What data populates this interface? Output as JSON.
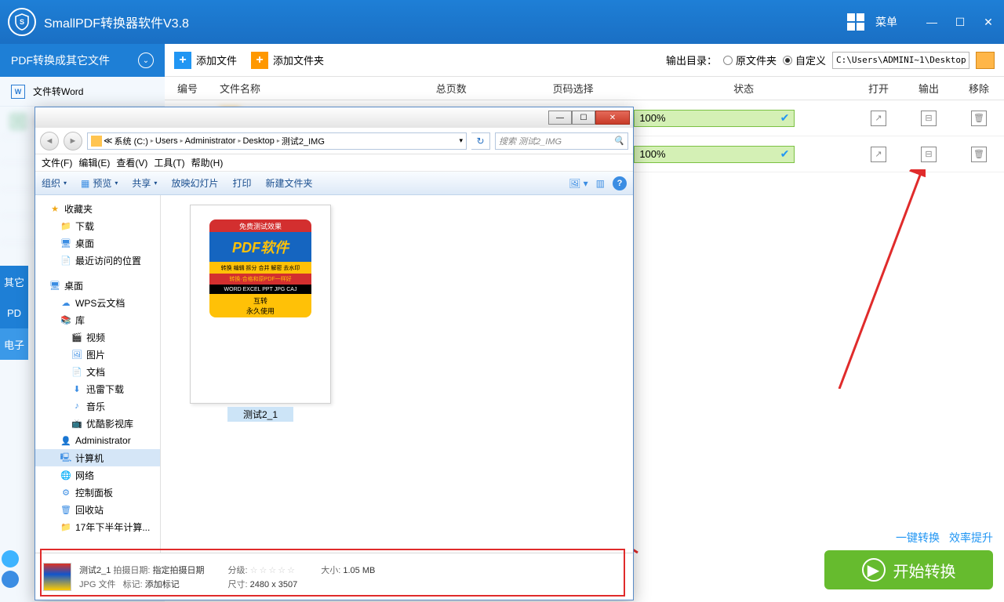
{
  "title_bar": {
    "app_title": "SmallPDF转换器软件V3.8",
    "menu_label": "菜单"
  },
  "sidebar": {
    "header": "PDF转换成其它文件",
    "items": [
      {
        "icon": "W",
        "color": "#2b7cd3",
        "label": "文件转Word"
      }
    ],
    "strip": [
      "其它",
      "PD",
      "电子"
    ]
  },
  "toolbar": {
    "add_file": "添加文件",
    "add_folder": "添加文件夹",
    "out_dir_label": "输出目录：",
    "radio_original": "原文件夹",
    "radio_custom": "自定义",
    "path": "C:\\Users\\ADMINI~1\\Desktop"
  },
  "grid": {
    "cols": {
      "num": "编号",
      "name": "文件名称",
      "pages": "总页数",
      "sel": "页码选择",
      "status": "状态",
      "open": "打开",
      "out": "输出",
      "del": "移除"
    },
    "rows": [
      {
        "status": "100%"
      },
      {
        "status": "100%"
      }
    ]
  },
  "footer": {
    "link1": "一键转换",
    "link2": "效率提升",
    "start": "开始转换"
  },
  "explorer": {
    "breadcrumb": [
      "系统 (C:)",
      "Users",
      "Administrator",
      "Desktop",
      "测试2_IMG"
    ],
    "search_hint": "搜索 测试2_IMG",
    "menubar": [
      "文件(F)",
      "编辑(E)",
      "查看(V)",
      "工具(T)",
      "帮助(H)"
    ],
    "tools": {
      "org": "组织",
      "preview": "预览",
      "share": "共享",
      "slideshow": "放映幻灯片",
      "print": "打印",
      "newfolder": "新建文件夹"
    },
    "tree": {
      "fav": "收藏夹",
      "downloads": "下载",
      "desktop": "桌面",
      "recent": "最近访问的位置",
      "desktop2": "桌面",
      "wps": "WPS云文档",
      "lib": "库",
      "video": "视频",
      "pic": "图片",
      "doc": "文档",
      "xunlei": "迅雷下载",
      "music": "音乐",
      "youku": "优酷影视库",
      "admin": "Administrator",
      "computer": "计算机",
      "network": "网络",
      "control": "控制面板",
      "recycle": "回收站",
      "folder17": "17年下半年计算..."
    },
    "file": {
      "name": "测试2_1",
      "thumb_banner": "免费测试效果",
      "thumb_main": "PDF软件",
      "thumb_row1": "转换 编辑 拆分 合并 解密 去水印",
      "thumb_row2": "转换·合格和原PDF一样好",
      "thumb_row3": "WORD EXCEL PPT JPG CAJ",
      "thumb_foot1": "互转",
      "thumb_foot2": "永久使用"
    },
    "detail": {
      "name": "测试2_1",
      "date_label": "拍摄日期:",
      "date_val": "指定拍摄日期",
      "type": "JPG 文件",
      "tag_label": "标记:",
      "tag_val": "添加标记",
      "rating_label": "分级:",
      "dim_label": "尺寸:",
      "dim_val": "2480 x 3507",
      "size_label": "大小:",
      "size_val": "1.05 MB"
    }
  }
}
